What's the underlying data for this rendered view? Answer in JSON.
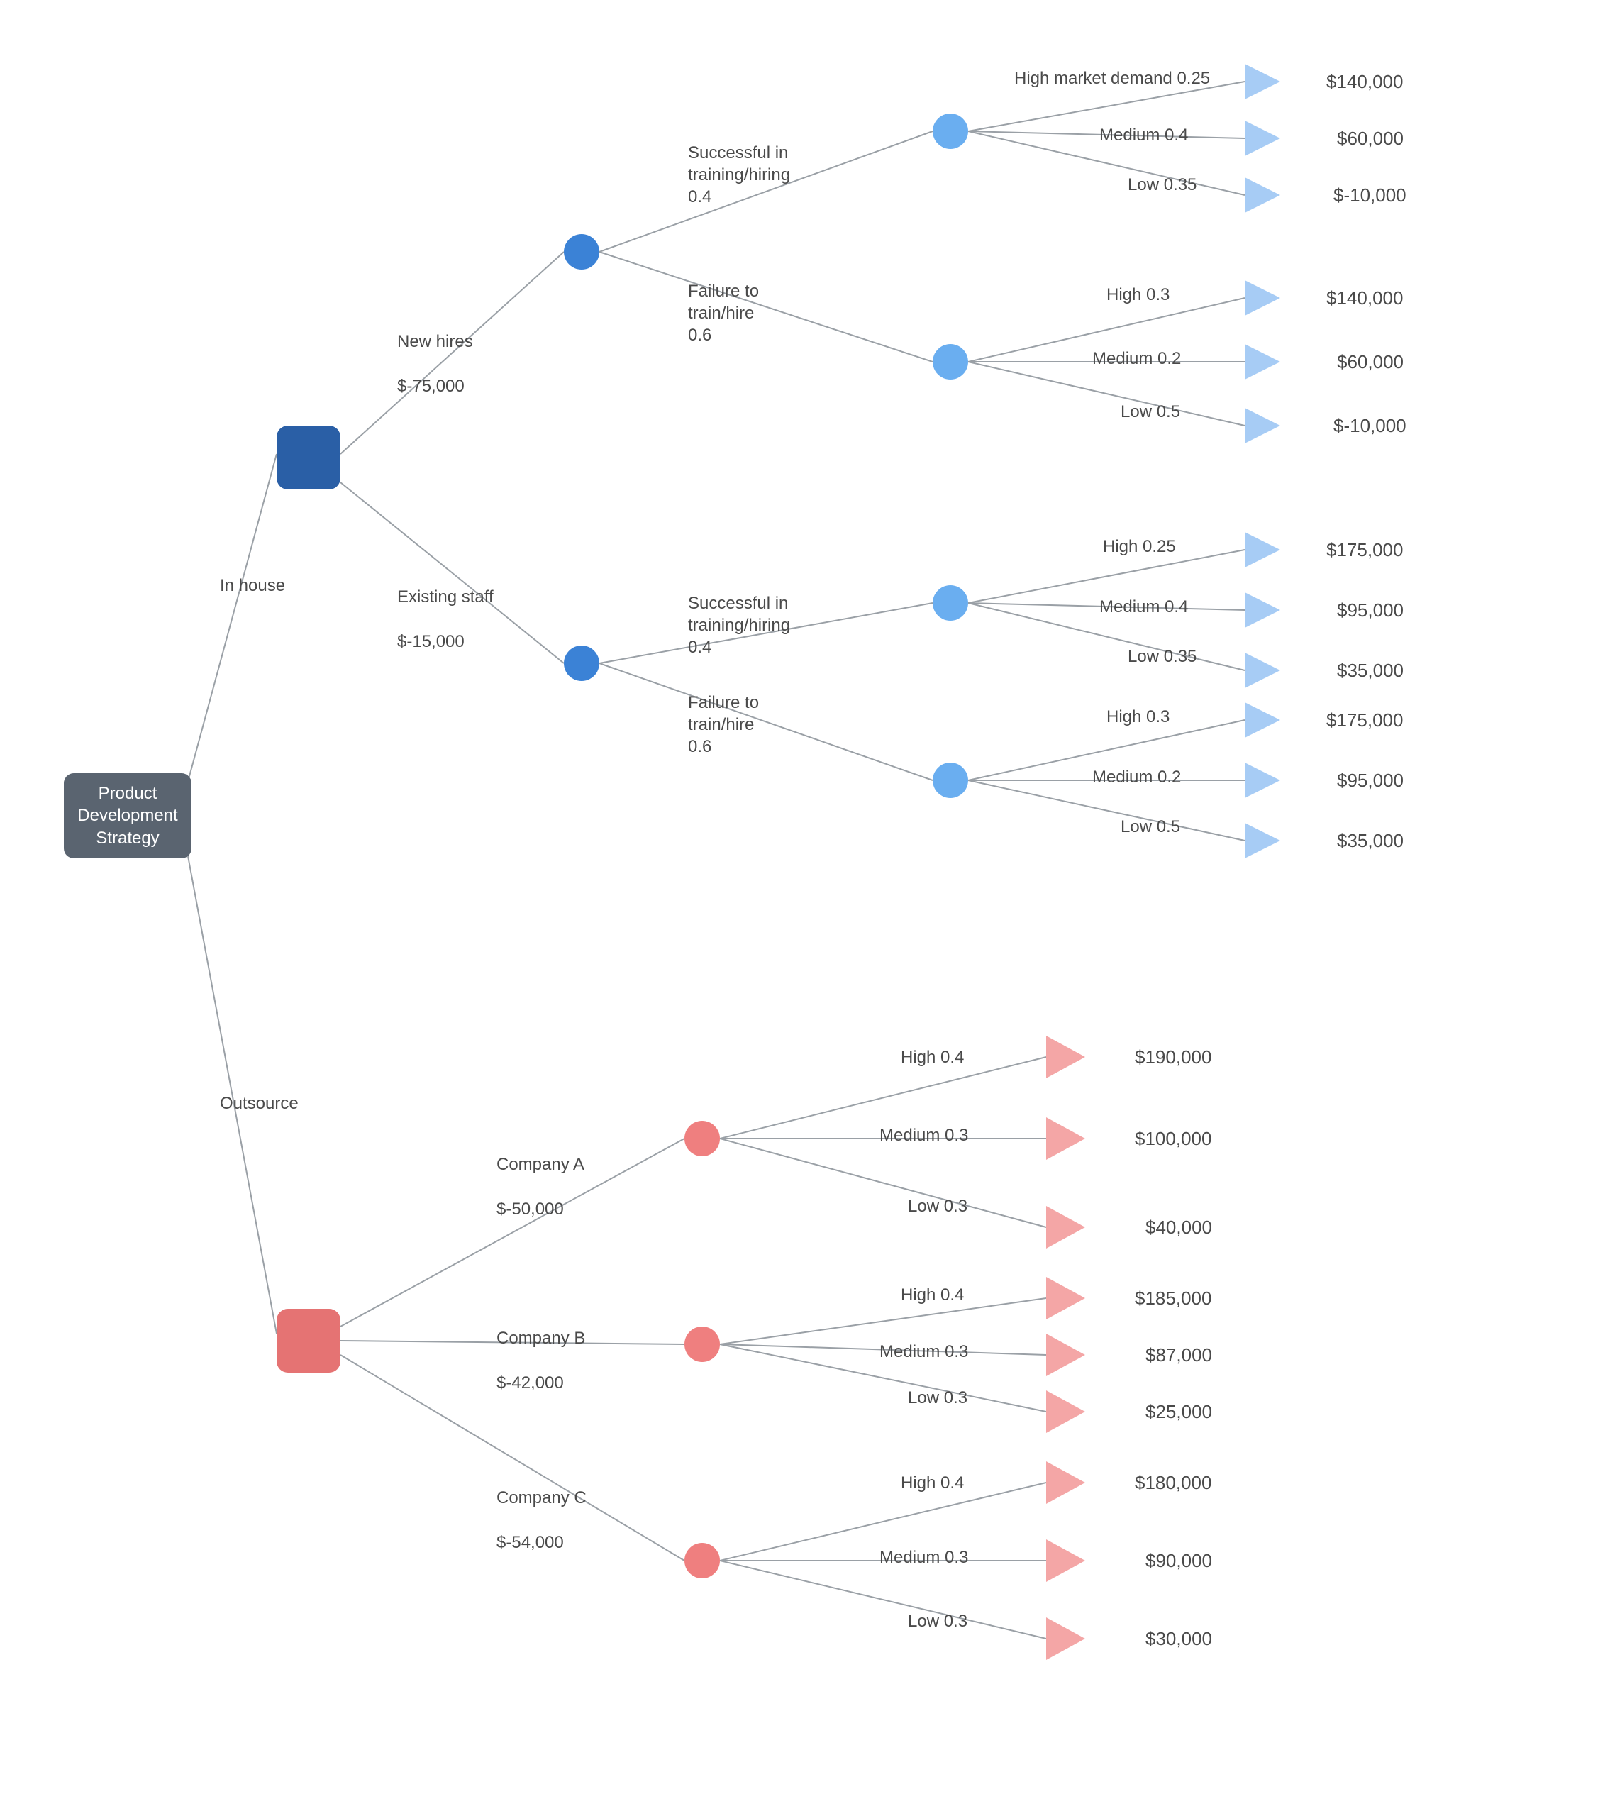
{
  "chart_data": {
    "type": "decision-tree",
    "root": {
      "label": "Product\nDevelopment\nStrategy"
    },
    "branches": [
      {
        "name": "In house",
        "children": [
          {
            "name": "New hires",
            "cost": "$-75,000",
            "children": [
              {
                "name": "Successful in training/hiring",
                "prob": "0.4",
                "outcomes": [
                  {
                    "label": "High market demand",
                    "prob": "0.25",
                    "value": "$140,000"
                  },
                  {
                    "label": "Medium",
                    "prob": "0.4",
                    "value": "$60,000"
                  },
                  {
                    "label": "Low",
                    "prob": "0.35",
                    "value": "$-10,000"
                  }
                ]
              },
              {
                "name": "Failure to train/hire",
                "prob": "0.6",
                "outcomes": [
                  {
                    "label": "High",
                    "prob": "0.3",
                    "value": "$140,000"
                  },
                  {
                    "label": "Medium",
                    "prob": "0.2",
                    "value": "$60,000"
                  },
                  {
                    "label": "Low",
                    "prob": "0.5",
                    "value": "$-10,000"
                  }
                ]
              }
            ]
          },
          {
            "name": "Existing staff",
            "cost": "$-15,000",
            "children": [
              {
                "name": "Successful in training/hiring",
                "prob": "0.4",
                "outcomes": [
                  {
                    "label": "High",
                    "prob": "0.25",
                    "value": "$175,000"
                  },
                  {
                    "label": "Medium",
                    "prob": "0.4",
                    "value": "$95,000"
                  },
                  {
                    "label": "Low",
                    "prob": "0.35",
                    "value": "$35,000"
                  }
                ]
              },
              {
                "name": "Failure to train/hire",
                "prob": "0.6",
                "outcomes": [
                  {
                    "label": "High",
                    "prob": "0.3",
                    "value": "$175,000"
                  },
                  {
                    "label": "Medium",
                    "prob": "0.2",
                    "value": "$95,000"
                  },
                  {
                    "label": "Low",
                    "prob": "0.5",
                    "value": "$35,000"
                  }
                ]
              }
            ]
          }
        ]
      },
      {
        "name": "Outsource",
        "children": [
          {
            "name": "Company A",
            "cost": "$-50,000",
            "outcomes": [
              {
                "label": "High",
                "prob": "0.4",
                "value": "$190,000"
              },
              {
                "label": "Medium",
                "prob": "0.3",
                "value": "$100,000"
              },
              {
                "label": "Low",
                "prob": "0.3",
                "value": "$40,000"
              }
            ]
          },
          {
            "name": "Company B",
            "cost": "$-42,000",
            "outcomes": [
              {
                "label": "High",
                "prob": "0.4",
                "value": "$185,000"
              },
              {
                "label": "Medium",
                "prob": "0.3",
                "value": "$87,000"
              },
              {
                "label": "Low",
                "prob": "0.3",
                "value": "$25,000"
              }
            ]
          },
          {
            "name": "Company C",
            "cost": "$-54,000",
            "outcomes": [
              {
                "label": "High",
                "prob": "0.4",
                "value": "$180,000"
              },
              {
                "label": "Medium",
                "prob": "0.3",
                "value": "$90,000"
              },
              {
                "label": "Low",
                "prob": "0.3",
                "value": "$30,000"
              }
            ]
          }
        ]
      }
    ]
  },
  "labels": {
    "root": "Product\nDevelopment\nStrategy",
    "inhouse": "In house",
    "outsource": "Outsource",
    "newhires": "New hires",
    "newhires_cost": "$-75,000",
    "existing": "Existing staff",
    "existing_cost": "$-15,000",
    "succ": "Successful in\ntraining/hiring\n0.4",
    "fail": "Failure to\ntrain/hire\n0.6",
    "hmd": "High market demand 0.25",
    "med04": "Medium 0.4",
    "low035": "Low 0.35",
    "high03": "High 0.3",
    "med02": "Medium 0.2",
    "low05": "Low 0.5",
    "high025": "High 0.25",
    "v140": "$140,000",
    "v60": "$60,000",
    "vn10": "$-10,000",
    "v175": "$175,000",
    "v95": "$95,000",
    "v35": "$35,000",
    "compA": "Company A",
    "compA_cost": "$-50,000",
    "compB": "Company B",
    "compB_cost": "$-42,000",
    "compC": "Company C",
    "compC_cost": "$-54,000",
    "high04": "High 0.4",
    "med03": "Medium 0.3",
    "low03": "Low 0.3",
    "v190": "$190,000",
    "v100": "$100,000",
    "v40": "$40,000",
    "v185": "$185,000",
    "v87": "$87,000",
    "v25": "$25,000",
    "v180": "$180,000",
    "v90": "$90,000",
    "v30": "$30,000"
  }
}
